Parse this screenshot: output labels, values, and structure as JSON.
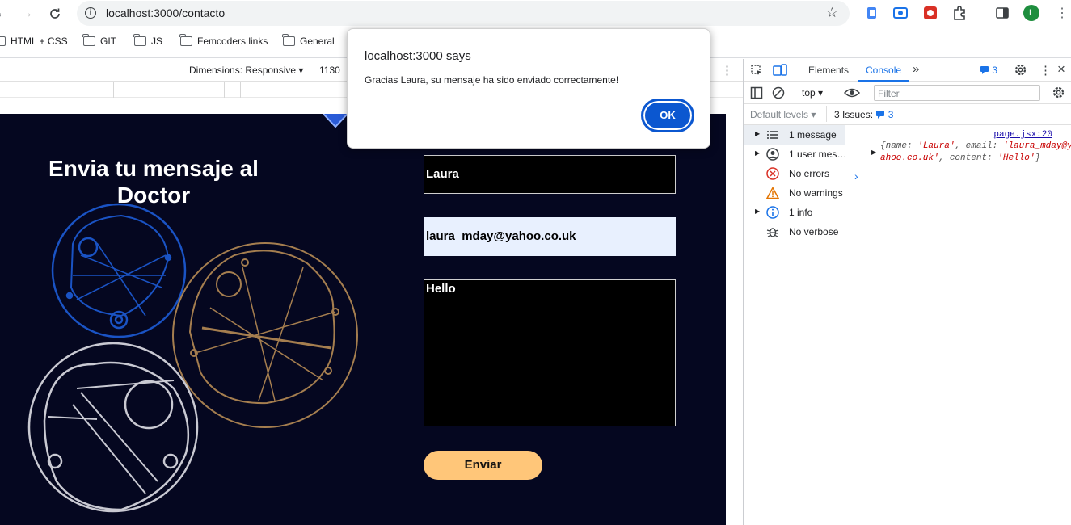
{
  "browser": {
    "url": "localhost:3000/contacto",
    "avatar_letter": "L",
    "bookmarks": [
      "HTML + CSS",
      "GIT",
      "JS",
      "Femcoders links",
      "General"
    ]
  },
  "device_toolbar": {
    "dimensions_label": "Dimensions: Responsive",
    "width_value": "1130"
  },
  "page": {
    "title": "Envia tu mensaje al Doctor",
    "name_value": "Laura",
    "email_value": "laura_mday@yahoo.co.uk",
    "message_value": "Hello",
    "send_label": "Enviar",
    "bg_color": "#050720",
    "button_color": "#ffc679"
  },
  "alert": {
    "title": "localhost:3000 says",
    "message": "Gracias Laura, su mensaje ha sido enviado correctamente!",
    "ok_label": "OK"
  },
  "devtools": {
    "tabs": [
      "Elements",
      "Console"
    ],
    "active_tab": "Console",
    "issues_badge": "3",
    "context": "top",
    "filter_placeholder": "Filter",
    "levels_label": "Default levels",
    "issues_label": "3 Issues:",
    "issues_count": "3",
    "sidebar": [
      {
        "label": "1 message",
        "icon": "list-icon",
        "expandable": true
      },
      {
        "label": "1 user mes…",
        "icon": "user-icon",
        "expandable": true
      },
      {
        "label": "No errors",
        "icon": "error-icon",
        "expandable": false
      },
      {
        "label": "No warnings",
        "icon": "warning-icon",
        "expandable": false
      },
      {
        "label": "1 info",
        "icon": "info-icon",
        "expandable": true
      },
      {
        "label": "No verbose",
        "icon": "bug-icon",
        "expandable": false
      }
    ],
    "log": {
      "source": "page.jsx:20",
      "name_key": "name",
      "name_val": "'Laura'",
      "email_key": "email",
      "email_val": "'laura_mday@yahoo.co.uk'",
      "content_key": "content",
      "content_val": "'Hello'"
    }
  }
}
